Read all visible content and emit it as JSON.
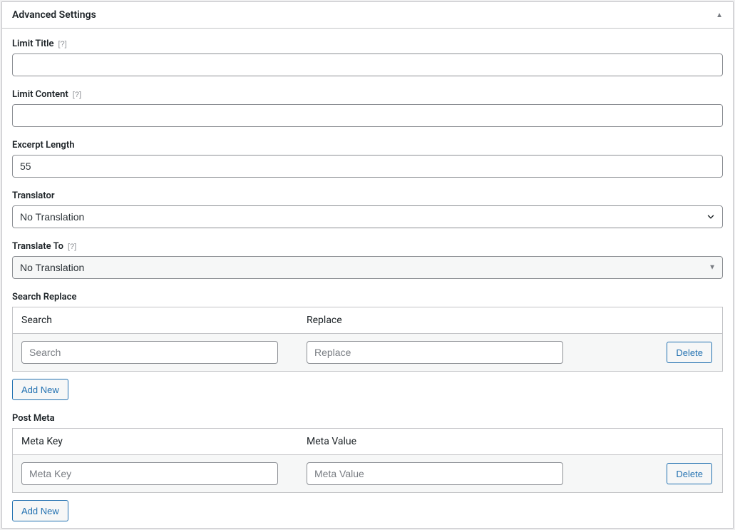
{
  "panel": {
    "title": "Advanced Settings"
  },
  "fields": {
    "limit_title": {
      "label": "Limit Title",
      "help": "[?]",
      "value": ""
    },
    "limit_content": {
      "label": "Limit Content",
      "help": "[?]",
      "value": ""
    },
    "excerpt_length": {
      "label": "Excerpt Length",
      "value": "55"
    },
    "translator": {
      "label": "Translator",
      "selected": "No Translation"
    },
    "translate_to": {
      "label": "Translate To",
      "help": "[?]",
      "selected": "No Translation"
    },
    "search_replace": {
      "label": "Search Replace",
      "header_search": "Search",
      "header_replace": "Replace",
      "row": {
        "search_placeholder": "Search",
        "search_value": "",
        "replace_placeholder": "Replace",
        "replace_value": "",
        "delete_label": "Delete"
      },
      "add_new_label": "Add New"
    },
    "post_meta": {
      "label": "Post Meta",
      "header_key": "Meta Key",
      "header_value": "Meta Value",
      "row": {
        "key_placeholder": "Meta Key",
        "key_value": "",
        "value_placeholder": "Meta Value",
        "value_value": "",
        "delete_label": "Delete"
      },
      "add_new_label": "Add New"
    }
  }
}
